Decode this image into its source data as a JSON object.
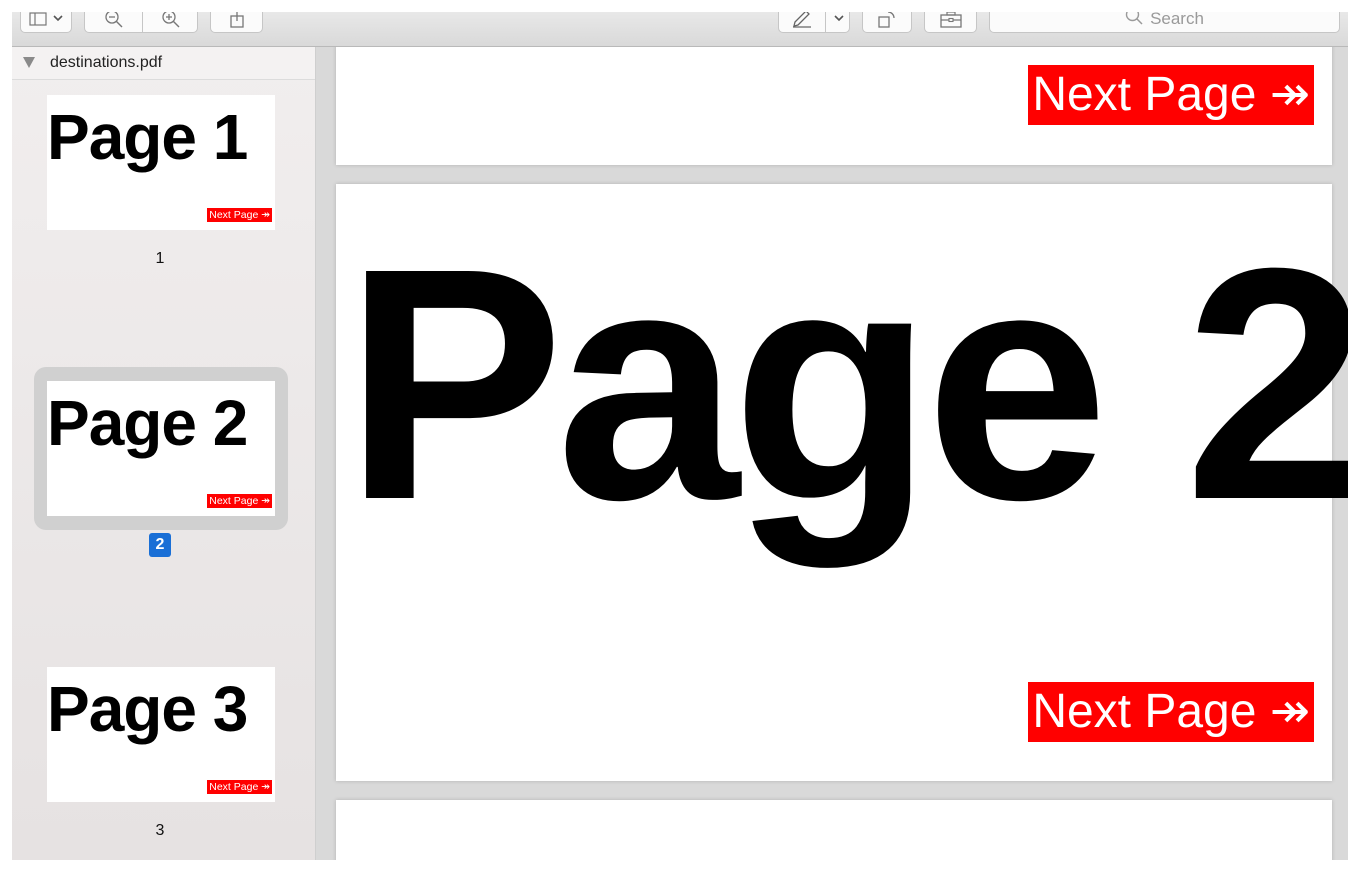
{
  "toolbar": {
    "search_placeholder": "Search",
    "icons": [
      "sidebar-icon",
      "chevron-down-icon",
      "zoom-out-icon",
      "zoom-in-icon",
      "share-icon",
      "pen-icon",
      "chevron-down-icon",
      "rotate-icon",
      "toolbox-icon",
      "search-icon"
    ]
  },
  "sidebar": {
    "filename": "destinations.pdf",
    "thumbnails": [
      {
        "title": "Page 1",
        "link": "Next Page ↠",
        "number": "1"
      },
      {
        "title": "Page 2",
        "link": "Next Page ↠",
        "number": "2"
      },
      {
        "title": "Page 3",
        "link": "Next Page ↠",
        "number": "3"
      }
    ],
    "selected_index": 1
  },
  "main": {
    "page1_link": "Next Page ↠",
    "page2_title": "Page 2",
    "page2_link": "Next Page ↠"
  },
  "colors": {
    "link_bg": "#ff0000",
    "selection_accent": "#1a6fd6"
  }
}
